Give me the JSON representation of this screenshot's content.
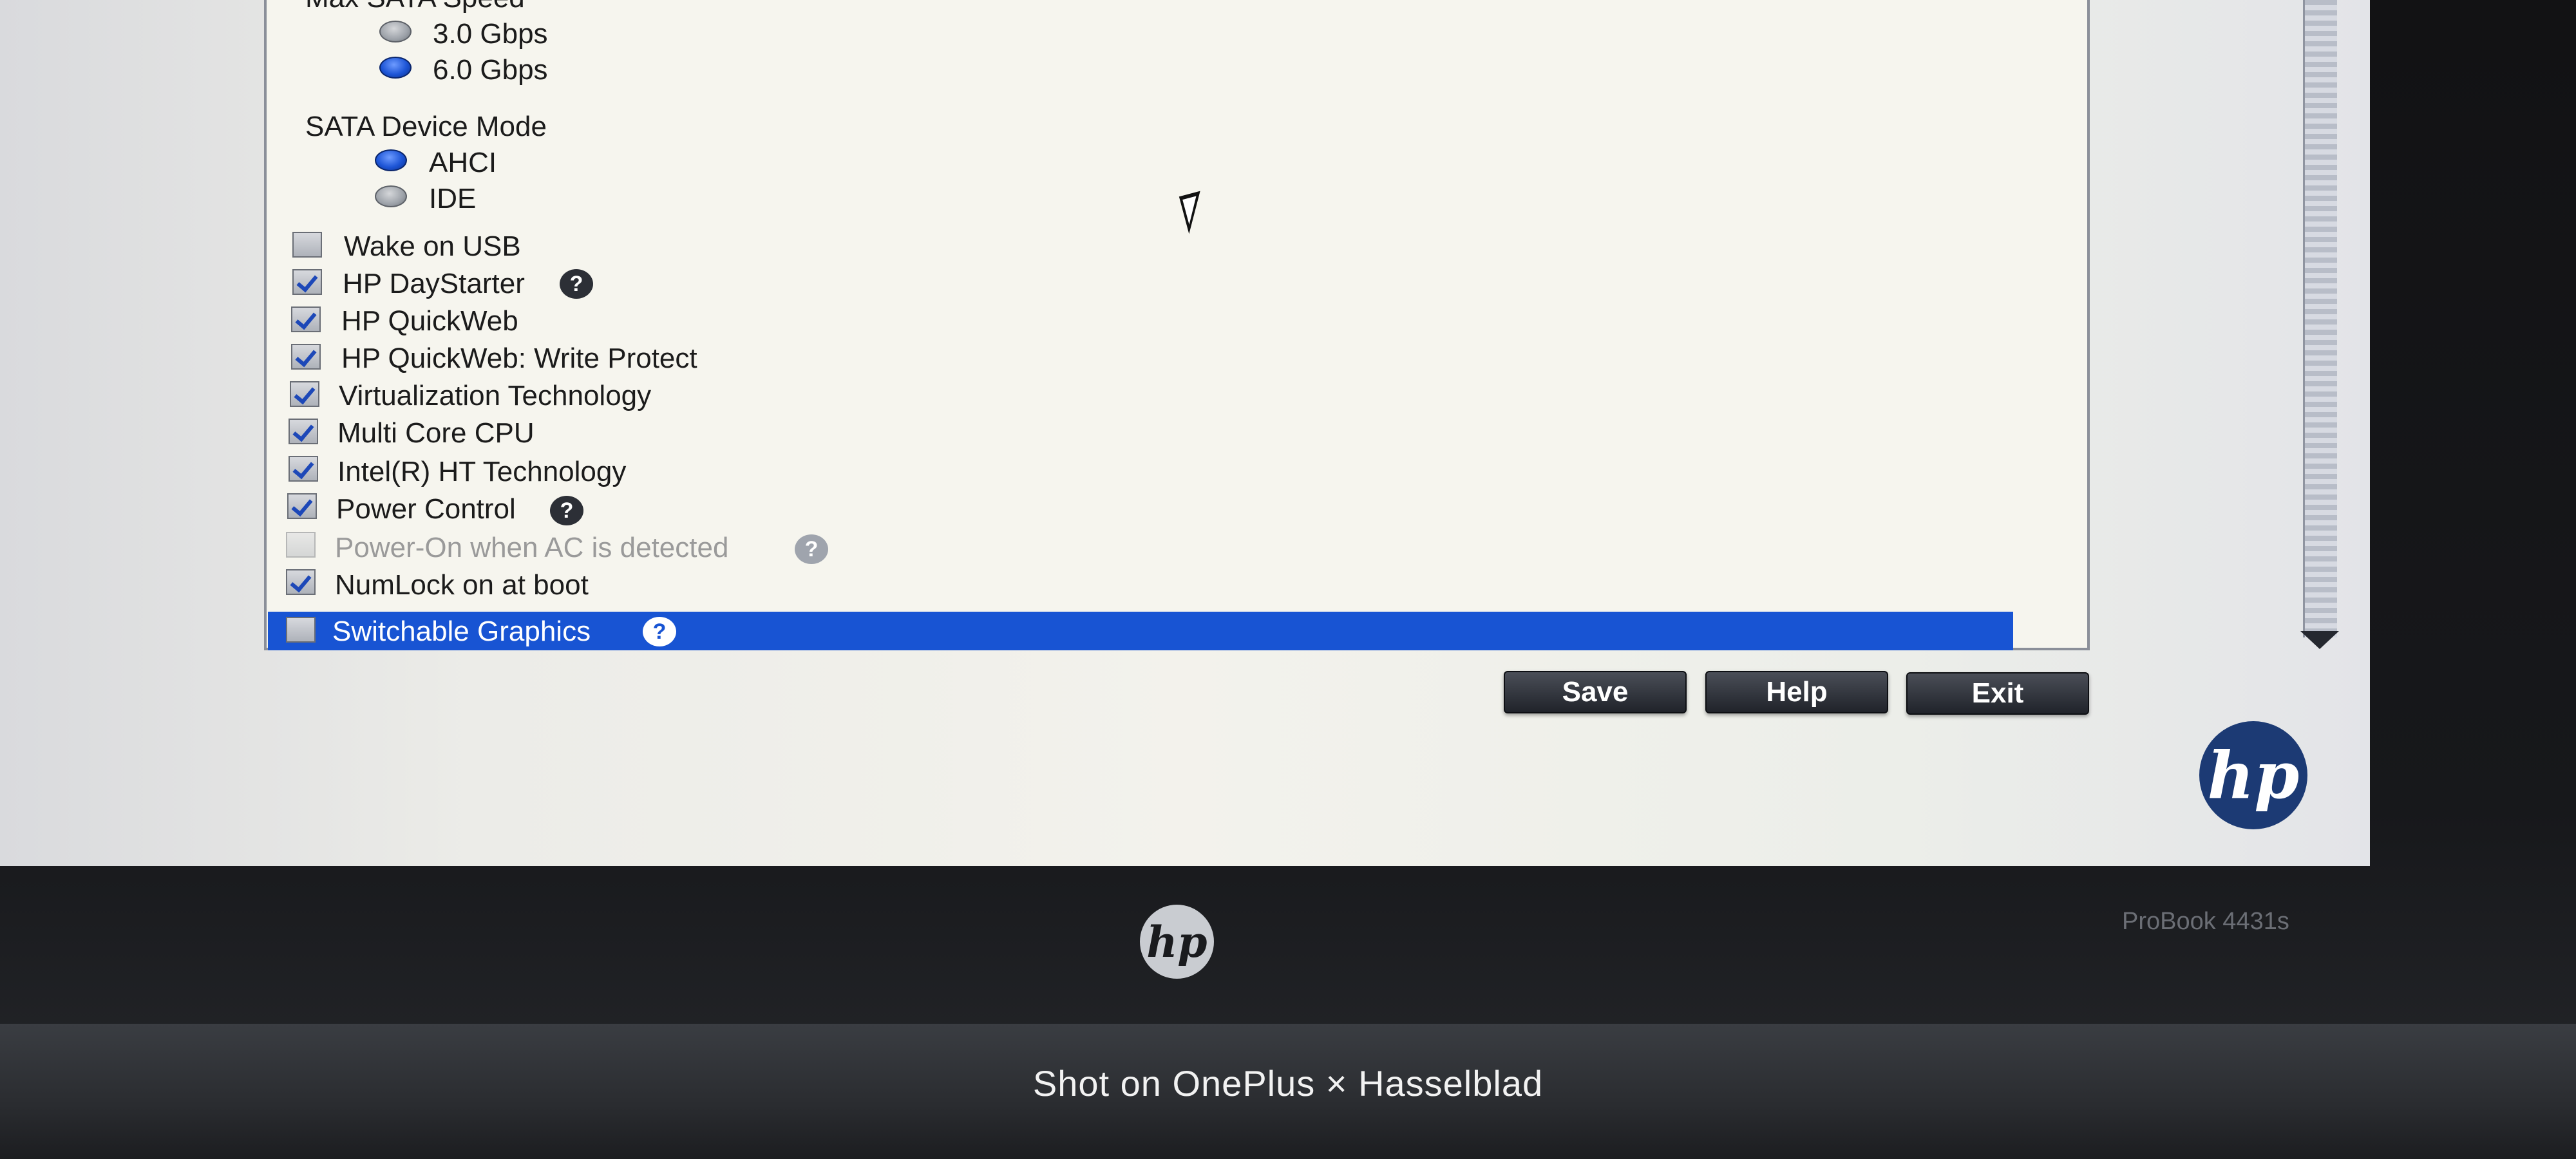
{
  "sata_speed": {
    "title": "Max SATA Speed",
    "options": [
      {
        "label": "3.0 Gbps",
        "selected": false
      },
      {
        "label": "6.0 Gbps",
        "selected": true
      }
    ]
  },
  "sata_mode": {
    "title": "SATA Device Mode",
    "options": [
      {
        "label": "AHCI",
        "selected": true
      },
      {
        "label": "IDE",
        "selected": false
      }
    ]
  },
  "options": [
    {
      "label": "Wake on USB",
      "checked": false,
      "help": false
    },
    {
      "label": "HP DayStarter",
      "checked": true,
      "help": true
    },
    {
      "label": "HP QuickWeb",
      "checked": true,
      "help": false
    },
    {
      "label": "HP QuickWeb: Write Protect",
      "checked": true,
      "help": false
    },
    {
      "label": "Virtualization Technology",
      "checked": true,
      "help": false
    },
    {
      "label": "Multi Core CPU",
      "checked": true,
      "help": false
    },
    {
      "label": "Intel(R) HT Technology",
      "checked": true,
      "help": false
    },
    {
      "label": "Power Control",
      "checked": true,
      "help": true
    },
    {
      "label": "Power-On when AC is detected",
      "checked": false,
      "help": true,
      "disabled": true
    },
    {
      "label": "NumLock on at boot",
      "checked": true,
      "help": false
    },
    {
      "label": "Switchable Graphics",
      "checked": false,
      "help": true,
      "highlighted": true
    }
  ],
  "help_glyph": "?",
  "buttons": {
    "save": "Save",
    "help": "Help",
    "exit": "Exit"
  },
  "branding": {
    "logo_text": "hp",
    "model": "ProBook 4431s",
    "watermark": "Shot on OnePlus × Hasselblad"
  },
  "colors": {
    "highlight": "#1854d3",
    "panel": "#f6f5ee"
  }
}
